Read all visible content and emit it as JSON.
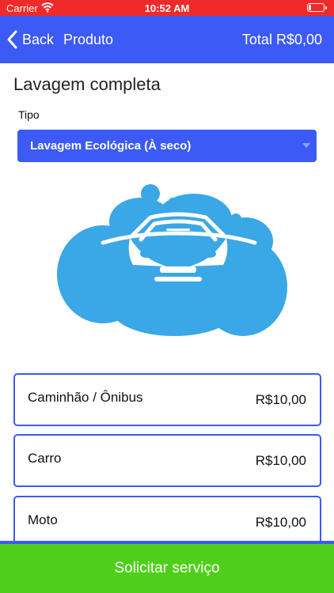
{
  "status_bar": {
    "carrier": "Carrier",
    "time": "10:52 AM",
    "wifi_icon": "wifi-icon",
    "battery_icon": "battery-icon"
  },
  "navbar": {
    "back_label": "Back",
    "title": "Produto",
    "total": "Total R$0,00",
    "back_icon": "chevron-left-icon",
    "color": "#3c5af5"
  },
  "product": {
    "title": "Lavagem completa",
    "type_label": "Tipo",
    "type_selected": "Lavagem Ecológica (À seco)",
    "illustration": "car-wash-bubbles-icon"
  },
  "options": [
    {
      "name": "Caminhão / Ônibus",
      "price": "R$10,00"
    },
    {
      "name": "Carro",
      "price": "R$10,00"
    },
    {
      "name": "Moto",
      "price": "R$10,00"
    }
  ],
  "action": {
    "submit_label": "Solicitar serviço",
    "color": "#4fcf1a"
  },
  "colors": {
    "status_bar": "#ef2a2a",
    "accent": "#3c5af5",
    "illustration": "#3aa7e6"
  }
}
